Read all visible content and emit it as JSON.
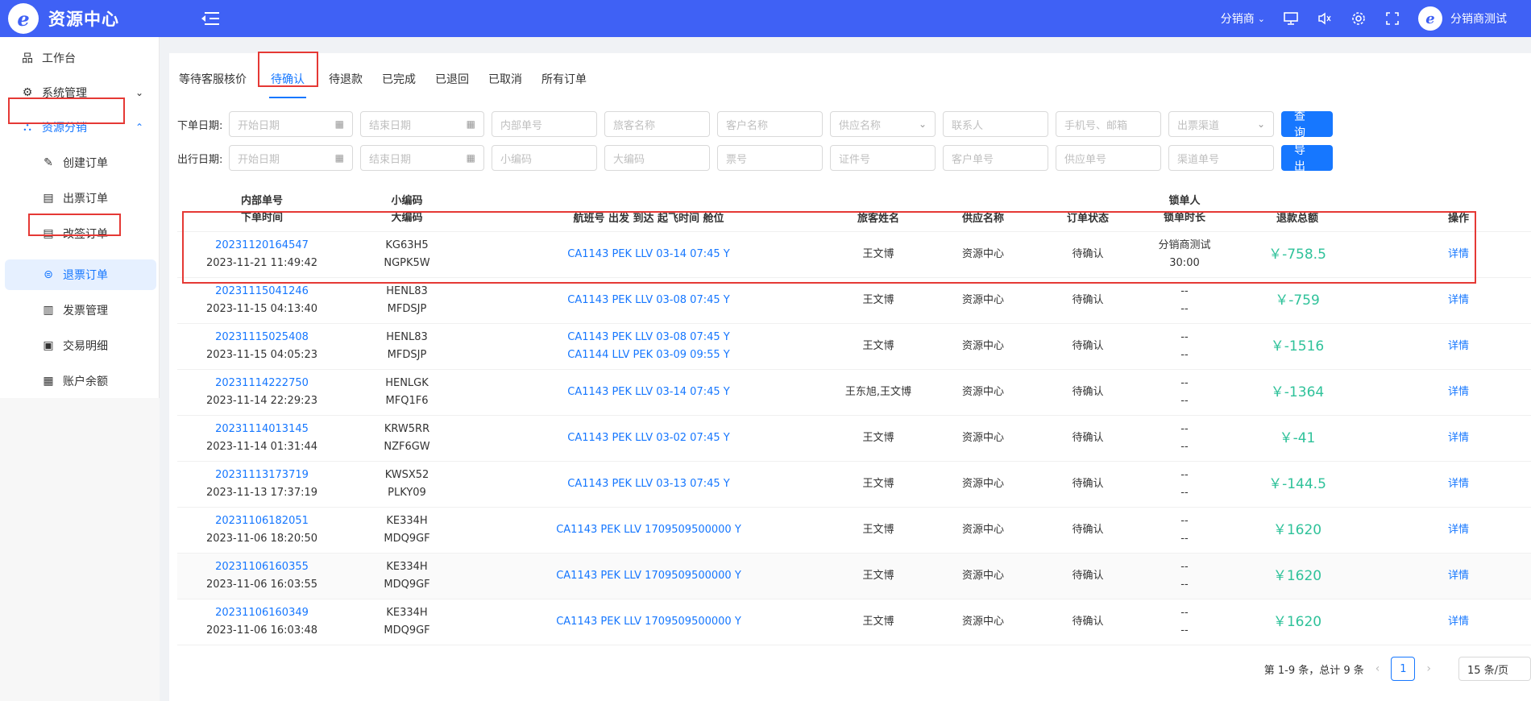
{
  "header": {
    "logo_letter": "e",
    "app_title": "资源中心",
    "role_select": "分销商",
    "user_name": "分销商测试"
  },
  "sidebar": {
    "items": [
      {
        "label": "工作台",
        "icon": "sitemap-icon"
      },
      {
        "label": "系统管理",
        "icon": "gear-icon"
      },
      {
        "label": "资源分销",
        "icon": "share-icon"
      },
      {
        "label": "创建订单",
        "icon": "pencil-icon"
      },
      {
        "label": "出票订单",
        "icon": "document-icon"
      },
      {
        "label": "改签订单",
        "icon": "document-icon"
      },
      {
        "label": "退票订单",
        "icon": "refund-icon"
      },
      {
        "label": "发票管理",
        "icon": "receipt-icon"
      },
      {
        "label": "交易明细",
        "icon": "monitor-icon"
      },
      {
        "label": "账户余额",
        "icon": "calendar-icon"
      }
    ]
  },
  "tabs": [
    "等待客服核价",
    "待确认",
    "待退款",
    "已完成",
    "已退回",
    "已取消",
    "所有订单"
  ],
  "filters": {
    "order_date_label": "下单日期:",
    "travel_date_label": "出行日期:",
    "start_date": "开始日期",
    "end_date": "结束日期",
    "internal_no": "内部单号",
    "passenger_name": "旅客名称",
    "customer_name": "客户名称",
    "supplier_name": "供应名称",
    "contact": "联系人",
    "phone_email": "手机号、邮箱",
    "channel": "出票渠道",
    "small_code": "小编码",
    "big_code": "大编码",
    "ticket_no": "票号",
    "id_no": "证件号",
    "customer_order_no": "客户单号",
    "supplier_order_no": "供应单号",
    "channel_order_no": "渠道单号",
    "query_btn": "查 询",
    "export_btn": "导 出"
  },
  "table": {
    "headers": {
      "internal_no": "内部单号",
      "order_time": "下单时间",
      "small_code": "小编码",
      "big_code": "大编码",
      "flight": "航班号 出发 到达 起飞时间 舱位",
      "passenger": "旅客姓名",
      "supplier": "供应名称",
      "status": "订单状态",
      "locker": "锁单人",
      "lock_duration": "锁单时长",
      "refund_total": "退款总额",
      "action": "操作"
    },
    "rows": [
      {
        "no": "20231120164547",
        "time": "2023-11-21 11:49:42",
        "small": "KG63H5",
        "big": "NGPK5W",
        "flight1": "CA1143 PEK LLV 03-14 07:45 Y",
        "flight2": "",
        "passenger": "王文博",
        "supplier": "资源中心",
        "status": "待确认",
        "lock1": "分销商测试",
        "lock2": "30:00",
        "amount": "￥-758.5",
        "action": "详情"
      },
      {
        "no": "20231115041246",
        "time": "2023-11-15 04:13:40",
        "small": "HENL83",
        "big": "MFDSJP",
        "flight1": "CA1143 PEK LLV 03-08 07:45 Y",
        "flight2": "",
        "passenger": "王文博",
        "supplier": "资源中心",
        "status": "待确认",
        "lock1": "--",
        "lock2": "--",
        "amount": "￥-759",
        "action": "详情"
      },
      {
        "no": "20231115025408",
        "time": "2023-11-15 04:05:23",
        "small": "HENL83",
        "big": "MFDSJP",
        "flight1": "CA1143 PEK LLV 03-08 07:45 Y",
        "flight2": "CA1144 LLV PEK 03-09 09:55 Y",
        "passenger": "王文博",
        "supplier": "资源中心",
        "status": "待确认",
        "lock1": "--",
        "lock2": "--",
        "amount": "￥-1516",
        "action": "详情"
      },
      {
        "no": "20231114222750",
        "time": "2023-11-14 22:29:23",
        "small": "HENLGK",
        "big": "MFQ1F6",
        "flight1": "CA1143 PEK LLV 03-14 07:45 Y",
        "flight2": "",
        "passenger": "王东旭,王文博",
        "supplier": "资源中心",
        "status": "待确认",
        "lock1": "--",
        "lock2": "--",
        "amount": "￥-1364",
        "action": "详情"
      },
      {
        "no": "20231114013145",
        "time": "2023-11-14 01:31:44",
        "small": "KRW5RR",
        "big": "NZF6GW",
        "flight1": "CA1143 PEK LLV 03-02 07:45 Y",
        "flight2": "",
        "passenger": "王文博",
        "supplier": "资源中心",
        "status": "待确认",
        "lock1": "--",
        "lock2": "--",
        "amount": "￥-41",
        "action": "详情"
      },
      {
        "no": "20231113173719",
        "time": "2023-11-13 17:37:19",
        "small": "KWSX52",
        "big": "PLKY09",
        "flight1": "CA1143 PEK LLV 03-13 07:45 Y",
        "flight2": "",
        "passenger": "王文博",
        "supplier": "资源中心",
        "status": "待确认",
        "lock1": "--",
        "lock2": "--",
        "amount": "￥-144.5",
        "action": "详情"
      },
      {
        "no": "20231106182051",
        "time": "2023-11-06 18:20:50",
        "small": "KE334H",
        "big": "MDQ9GF",
        "flight1": "CA1143 PEK LLV 1709509500000 Y",
        "flight2": "",
        "passenger": "王文博",
        "supplier": "资源中心",
        "status": "待确认",
        "lock1": "--",
        "lock2": "--",
        "amount": "￥1620",
        "action": "详情"
      },
      {
        "no": "20231106160355",
        "time": "2023-11-06 16:03:55",
        "small": "KE334H",
        "big": "MDQ9GF",
        "flight1": "CA1143 PEK LLV 1709509500000 Y",
        "flight2": "",
        "passenger": "王文博",
        "supplier": "资源中心",
        "status": "待确认",
        "lock1": "--",
        "lock2": "--",
        "amount": "￥1620",
        "action": "详情"
      },
      {
        "no": "20231106160349",
        "time": "2023-11-06 16:03:48",
        "small": "KE334H",
        "big": "MDQ9GF",
        "flight1": "CA1143 PEK LLV 1709509500000 Y",
        "flight2": "",
        "passenger": "王文博",
        "supplier": "资源中心",
        "status": "待确认",
        "lock1": "--",
        "lock2": "--",
        "amount": "￥1620",
        "action": "详情"
      }
    ]
  },
  "pagination": {
    "summary": "第 1-9 条，总计 9 条",
    "current": "1",
    "page_size": "15 条/页"
  },
  "colors": {
    "brand": "#3f61f5",
    "link": "#1677ff",
    "amount": "#2fc29a",
    "highlight_box": "#e53935"
  }
}
